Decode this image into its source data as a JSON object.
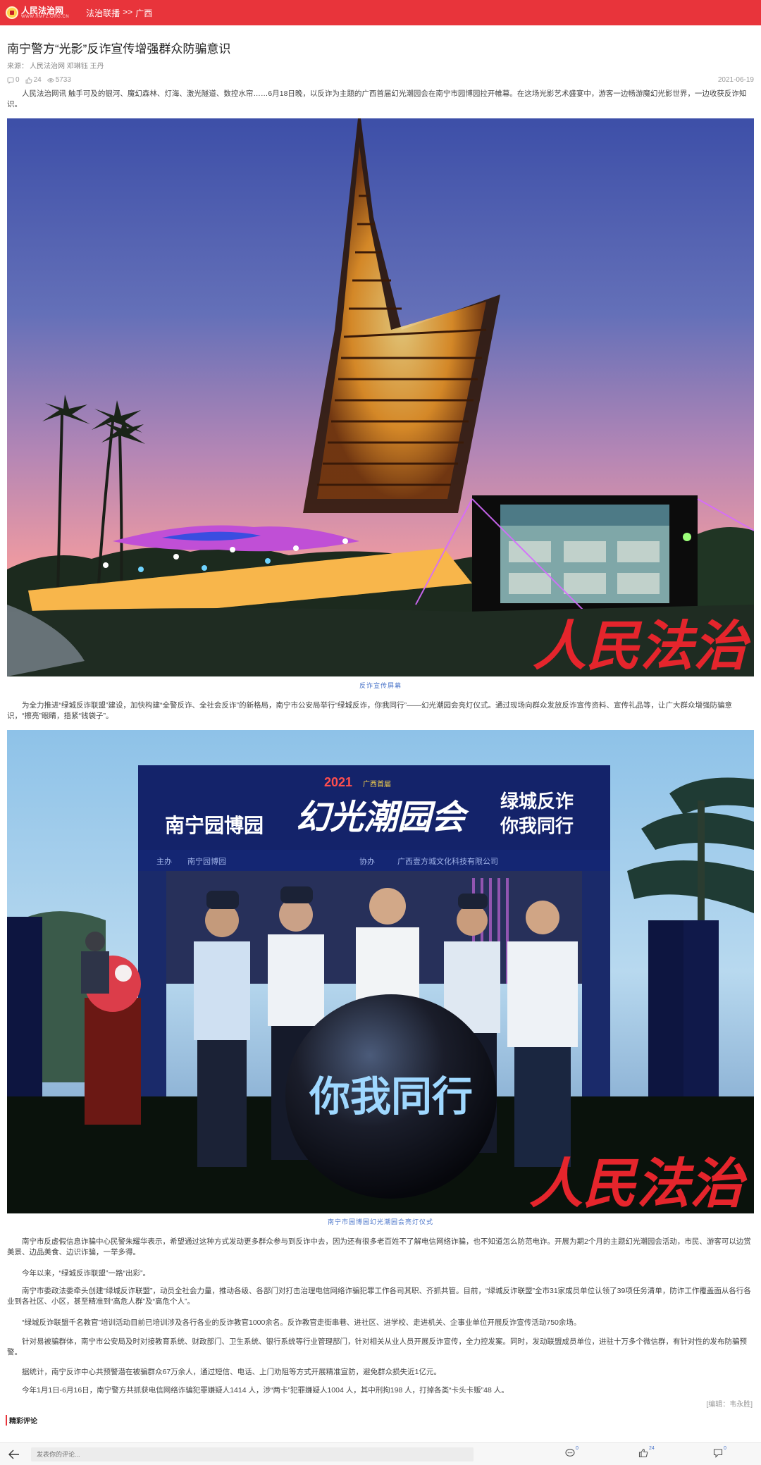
{
  "header": {
    "logo_text": "人民法治网",
    "logo_sub": "WWW.RMFZ.ORG.CN",
    "breadcrumb": [
      "法治联播",
      ">>",
      "广西"
    ]
  },
  "article": {
    "title": "南宁警方“光影”反诈宣传增强群众防骗意识",
    "source_label": "来源：",
    "source": "人民法治网 邓琳钰 王丹",
    "comments_count": "0",
    "likes_count": "24",
    "views_count": "5733",
    "date": "2021-06-19",
    "paragraphs": [
      "人民法治网讯 触手可及的银河、魔幻森林、灯海、激光隧道、数控水帘……6月18日晚，以反诈为主题的广西首届幻光潮园会在南宁市园博园拉开帷幕。在这场光影艺术盛宴中，游客一边畅游魔幻光影世界，一边收获反诈知识。",
      "为全力推进“绿城反诈联盟”建设，加快构建“全警反诈、全社会反诈”的新格局，南宁市公安局举行“绿城反诈，你我同行”——幻光潮园会亮灯仪式。通过现场向群众发放反诈宣传资料、宣传礼品等，让广大群众增强防骗意识，“擦亮”眼睛，捂紧“钱袋子”。",
      "南宁市反虚假信息诈骗中心民警朱耀华表示，希望通过这种方式发动更多群众参与到反诈中去，因为还有很多老百姓不了解电信网络诈骗，也不知道怎么防范电诈。开展为期2个月的主题幻光潮园会活动，市民、游客可以边赏美景、边品美食、边识诈骗，一举多得。",
      "今年以来，“绿城反诈联盟”一路“出彩”。",
      "南宁市委政法委牵头创建“绿城反诈联盟”，动员全社会力量，推动各级、各部门对打击治理电信网络诈骗犯罪工作各司其职、齐抓共管。目前，“绿城反诈联盟”全市31家成员单位认领了39项任务清单，防诈工作覆盖面从各行各业到各社区、小区，甚至精准到“高危人群”及“高危个人”。",
      "“绿城反诈联盟千名教官”培训活动目前已培训涉及各行各业的反诈教官1000余名。反诈教官走街串巷、进社区、进学校、走进机关、企事业单位开展反诈宣传活动750余场。",
      "针对易被骗群体，南宁市公安局及时对接教育系统、财政部门、卫生系统、银行系统等行业管理部门，针对相关从业人员开展反诈宣传，全力控发案。同时，发动联盟成员单位，进驻十万多个微信群，有针对性的发布防骗预警。",
      "据统计，南宁反诈中心共预警潜在被骗群众67万余人，通过短信、电话、上门劝阻等方式开展精准宣防，避免群众损失近1亿元。",
      "今年1月1日-6月16日，南宁警方共抓获电信网络诈骗犯罪嫌疑人1414 人，涉“两卡”犯罪嫌疑人1004 人，其中刑拘198 人，打掉各类“卡头卡贩”48 人。"
    ],
    "photo1": {
      "caption": "反诈宣传屏幕",
      "watermark": "人民法治"
    },
    "photo2": {
      "caption": "南宁市园博园幻光潮园会亮灯仪式",
      "watermark": "人民法治",
      "banner_year": "2021",
      "banner_tag": "广西首届",
      "banner_left": "南宁园博园",
      "banner_main": "幻光潮园会",
      "banner_slogan_1": "绿城反诈",
      "banner_slogan_2": "你我同行",
      "banner_sub_left": "主办",
      "banner_sub_left_name": "南宁园博园",
      "banner_sub_right": "协办",
      "banner_sub_right_name": "广西壹方城文化科技有限公司",
      "ball_text": "你我同行"
    },
    "editor": "[编辑：韦永胜]"
  },
  "comments": {
    "heading": "精彩评论"
  },
  "bottom_bar": {
    "input_placeholder": "发表你的评论...",
    "comment_badge": "0",
    "like_badge": "24",
    "share_badge": "0"
  },
  "colors": {
    "brand_red": "#e8343b",
    "caption_blue": "#4a74c9"
  }
}
